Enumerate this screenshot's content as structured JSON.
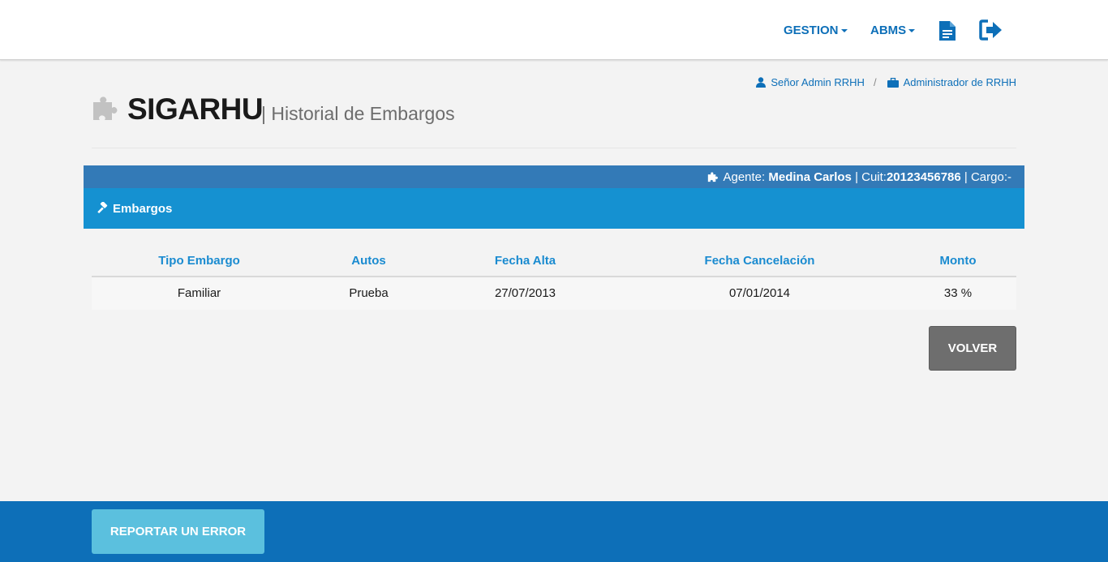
{
  "navbar": {
    "menus": [
      {
        "label": "GESTION"
      },
      {
        "label": "ABMS"
      }
    ],
    "icons": [
      "document-icon",
      "logout-icon"
    ]
  },
  "user": {
    "name": "Señor Admin RRHH",
    "separator": "/",
    "role": "Administrador de RRHH"
  },
  "page": {
    "title": "SIGARHU",
    "subtitle": "| Historial de Embargos"
  },
  "agent_bar": {
    "agent_label": "Agente:",
    "agent_name": "Medina Carlos",
    "cuit_label": "| Cuit:",
    "cuit_value": "20123456786",
    "cargo_label": "| Cargo:-"
  },
  "section": {
    "title": "Embargos"
  },
  "table": {
    "headers": [
      "Tipo Embargo",
      "Autos",
      "Fecha Alta",
      "Fecha Cancelación",
      "Monto"
    ],
    "rows": [
      [
        "Familiar",
        "Prueba",
        "27/07/2013",
        "07/01/2014",
        "33 %"
      ]
    ]
  },
  "actions": {
    "back_label": "VOLVER"
  },
  "footer": {
    "report_label": "REPORTAR UN ERROR"
  },
  "colors": {
    "brand_blue": "#0d6fb8",
    "agent_bar": "#337ab7",
    "section_bar": "#1591d1",
    "header_text": "#1a8bd0",
    "back_button": "#6e6e6e",
    "report_button": "#5bc0de"
  }
}
